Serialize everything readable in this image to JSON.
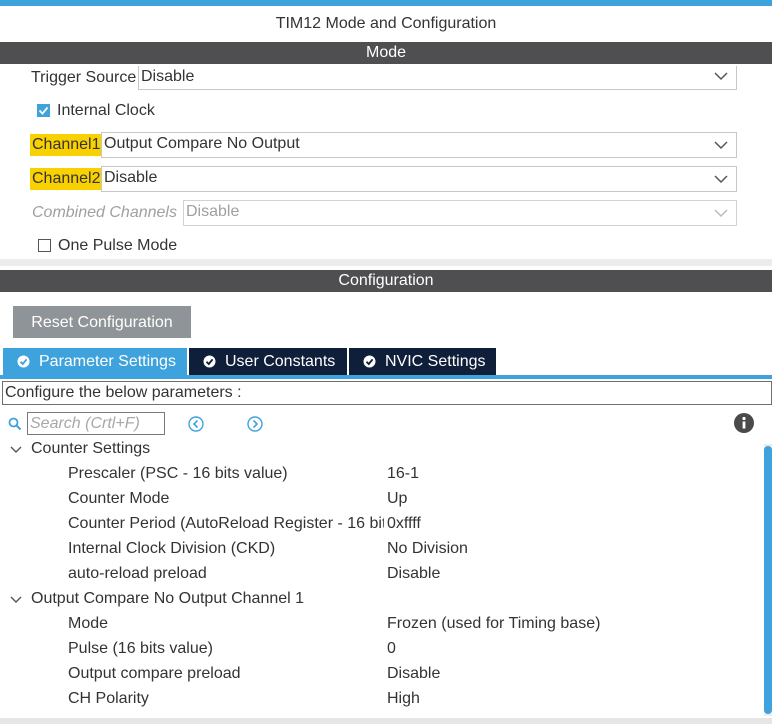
{
  "window": {
    "title": "TIM12 Mode and Configuration"
  },
  "mode": {
    "header": "Mode",
    "trigger_source": {
      "label": "Trigger Source",
      "value": "Disable"
    },
    "internal_clock": {
      "label": "Internal Clock",
      "checked": true
    },
    "channel1": {
      "label": "Channel1",
      "value": "Output Compare No Output"
    },
    "channel2": {
      "label": "Channel2",
      "value": "Disable"
    },
    "combined_channels": {
      "label": "Combined Channels",
      "value": "Disable"
    },
    "one_pulse_mode": {
      "label": "One Pulse Mode",
      "checked": false
    }
  },
  "configuration": {
    "header": "Configuration",
    "reset_button": "Reset Configuration",
    "tabs": [
      {
        "label": "Parameter Settings",
        "active": true
      },
      {
        "label": "User Constants",
        "active": false
      },
      {
        "label": "NVIC Settings",
        "active": false
      }
    ],
    "instruction": "Configure the below parameters :",
    "search": {
      "placeholder": "Search (Crtl+F)"
    },
    "groups": [
      {
        "title": "Counter Settings",
        "params": [
          {
            "name": "Prescaler (PSC - 16 bits value)",
            "value": "16-1"
          },
          {
            "name": "Counter Mode",
            "value": "Up"
          },
          {
            "name": "Counter Period (AutoReload Register - 16 bit...",
            "value": "0xffff"
          },
          {
            "name": "Internal Clock Division (CKD)",
            "value": "No Division"
          },
          {
            "name": "auto-reload preload",
            "value": "Disable"
          }
        ]
      },
      {
        "title": "Output Compare No Output Channel 1",
        "params": [
          {
            "name": "Mode",
            "value": "Frozen (used for Timing base)"
          },
          {
            "name": "Pulse (16 bits value)",
            "value": "0"
          },
          {
            "name": "Output compare preload",
            "value": "Disable"
          },
          {
            "name": "CH Polarity",
            "value": "High"
          }
        ]
      }
    ]
  },
  "colors": {
    "accent": "#3ea3dc",
    "header_bar": "#4f4f51",
    "tab_inactive": "#0f1f3a",
    "channel_highlight": "#f9d100",
    "button_grey": "#8f9498"
  },
  "icons": [
    "chevron-down-icon",
    "checkbox-icon",
    "check-circle-icon",
    "search-icon",
    "arrow-left-circle-icon",
    "arrow-right-circle-icon",
    "info-icon"
  ]
}
